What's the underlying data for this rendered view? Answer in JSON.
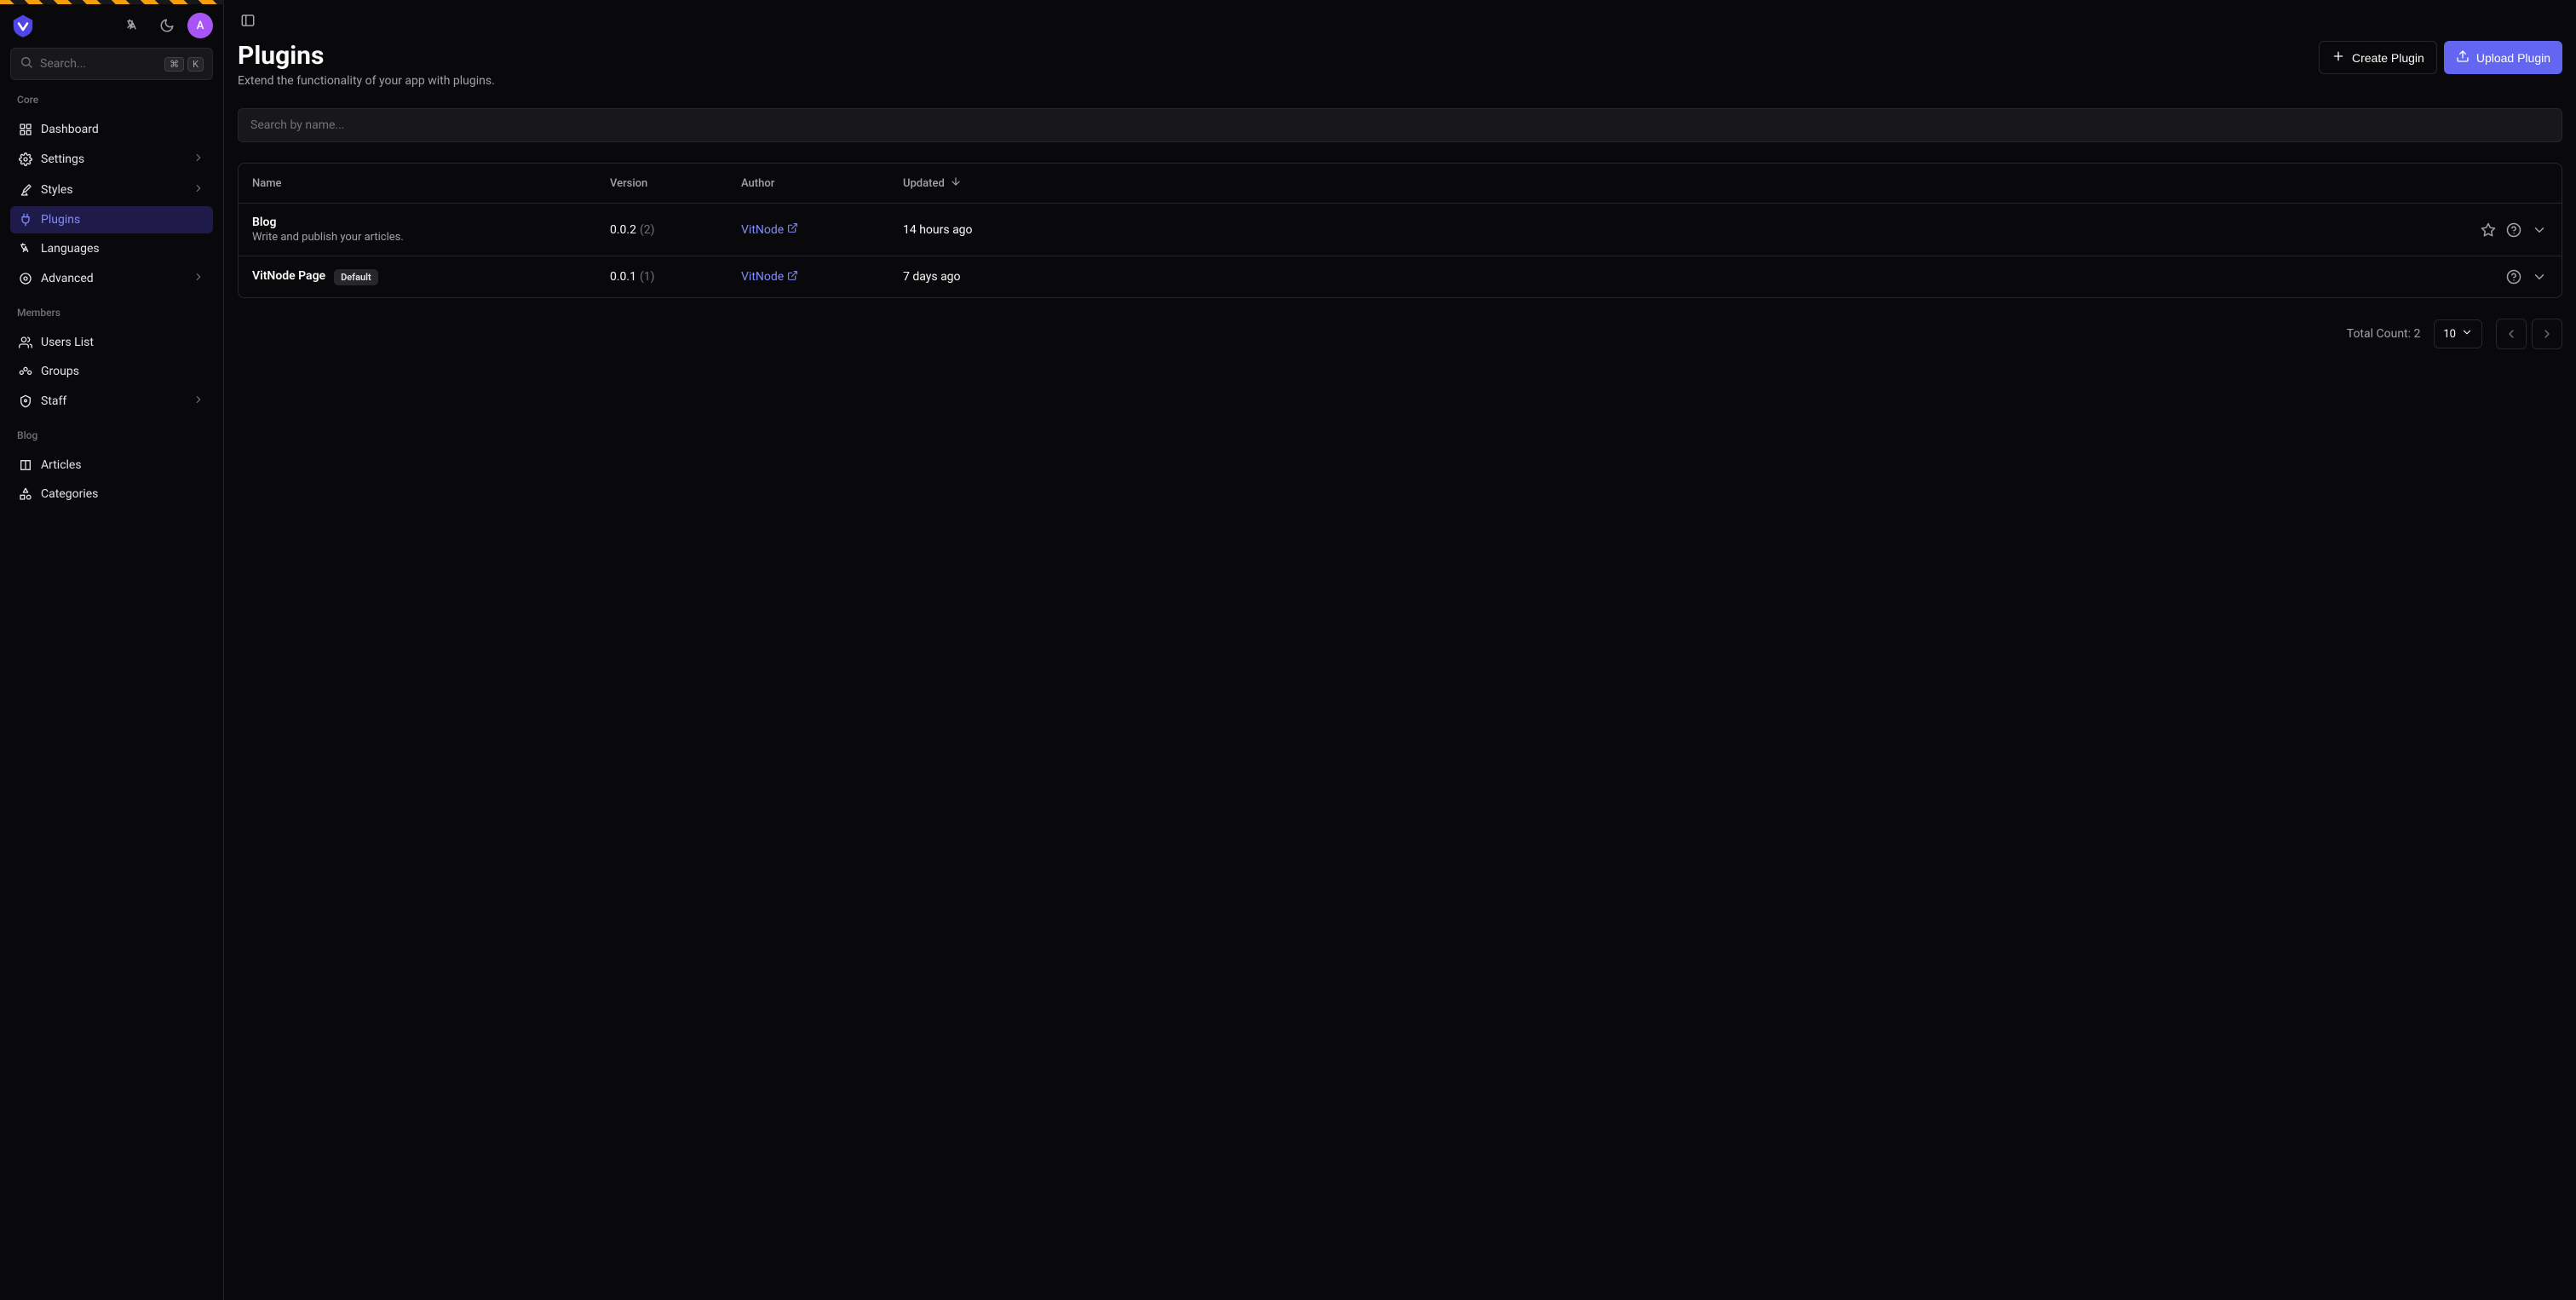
{
  "search": {
    "placeholder": "Search...",
    "kbd1": "⌘",
    "kbd2": "K"
  },
  "avatar_initial": "A",
  "sections": {
    "core": {
      "label": "Core",
      "items": [
        {
          "label": "Dashboard"
        },
        {
          "label": "Settings"
        },
        {
          "label": "Styles"
        },
        {
          "label": "Plugins"
        },
        {
          "label": "Languages"
        },
        {
          "label": "Advanced"
        }
      ]
    },
    "members": {
      "label": "Members",
      "items": [
        {
          "label": "Users List"
        },
        {
          "label": "Groups"
        },
        {
          "label": "Staff"
        }
      ]
    },
    "blog": {
      "label": "Blog",
      "items": [
        {
          "label": "Articles"
        },
        {
          "label": "Categories"
        }
      ]
    }
  },
  "page": {
    "title": "Plugins",
    "subtitle": "Extend the functionality of your app with plugins.",
    "create_btn": "Create Plugin",
    "upload_btn": "Upload Plugin",
    "filter_placeholder": "Search by name..."
  },
  "table": {
    "headers": {
      "name": "Name",
      "version": "Version",
      "author": "Author",
      "updated": "Updated"
    },
    "rows": [
      {
        "name": "Blog",
        "desc": "Write and publish your articles.",
        "version": "0.0.2",
        "count": "(2)",
        "author": "VitNode",
        "updated": "14 hours ago",
        "default": false,
        "starrable": true
      },
      {
        "name": "VitNode Page",
        "desc": "",
        "version": "0.0.1",
        "count": "(1)",
        "author": "VitNode",
        "updated": "7 days ago",
        "default": true,
        "starrable": false
      }
    ],
    "default_badge": "Default"
  },
  "footer": {
    "total_label": "Total Count: ",
    "total_value": "2",
    "page_size": "10"
  }
}
